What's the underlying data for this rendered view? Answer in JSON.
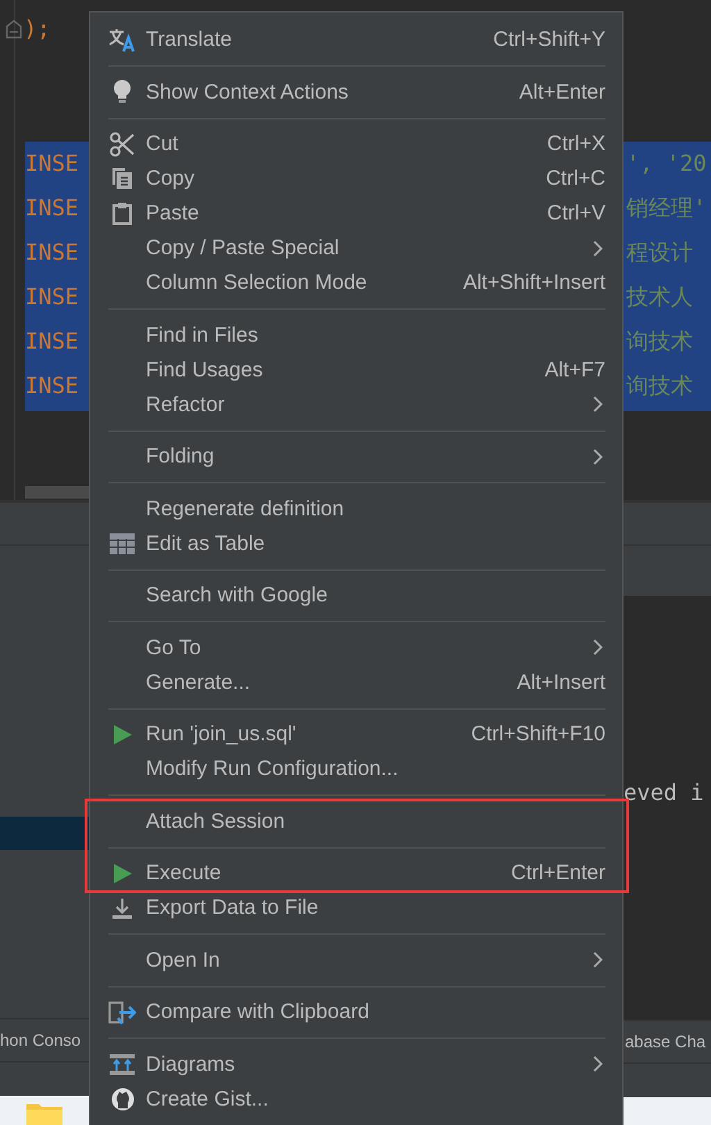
{
  "editor": {
    "top_line": ");",
    "selected_lines": [
      "INSE",
      "INSE",
      "INSE",
      "INSE",
      "INSE",
      "INSE"
    ],
    "right_fragments": [
      "', '20",
      "销经理'",
      "程设计",
      "技术人",
      "询技术",
      "询技术"
    ]
  },
  "console": {
    "output_fragment": "eved i"
  },
  "tool_tabs": [
    "hon Conso",
    "abase Cha"
  ],
  "context_menu": {
    "groups": [
      [
        {
          "label": "Translate",
          "shortcut": "Ctrl+Shift+Y",
          "submenu": false
        }
      ],
      [
        {
          "label": "Show Context Actions",
          "shortcut": "Alt+Enter",
          "submenu": false
        }
      ],
      [
        {
          "label": "Cut",
          "shortcut": "Ctrl+X",
          "submenu": false
        },
        {
          "label": "Copy",
          "shortcut": "Ctrl+C",
          "submenu": false
        },
        {
          "label": "Paste",
          "shortcut": "Ctrl+V",
          "submenu": false
        },
        {
          "label": "Copy / Paste Special",
          "submenu": true
        },
        {
          "label": "Column Selection Mode",
          "shortcut": "Alt+Shift+Insert",
          "submenu": false
        }
      ],
      [
        {
          "label": "Find in Files",
          "submenu": false
        },
        {
          "label": "Find Usages",
          "shortcut": "Alt+F7",
          "submenu": false
        },
        {
          "label": "Refactor",
          "submenu": true
        }
      ],
      [
        {
          "label": "Folding",
          "submenu": true
        }
      ],
      [
        {
          "label": "Regenerate definition",
          "submenu": false
        },
        {
          "label": "Edit as Table",
          "submenu": false
        }
      ],
      [
        {
          "label": "Search with Google",
          "submenu": false
        }
      ],
      [
        {
          "label": "Go To",
          "submenu": true
        },
        {
          "label": "Generate...",
          "shortcut": "Alt+Insert",
          "submenu": false
        }
      ],
      [
        {
          "label": "Run 'join_us.sql'",
          "shortcut": "Ctrl+Shift+F10",
          "submenu": false
        },
        {
          "label": "Modify Run Configuration...",
          "submenu": false
        }
      ],
      [
        {
          "label": "Attach Session",
          "submenu": false
        }
      ],
      [
        {
          "label": "Execute",
          "shortcut": "Ctrl+Enter",
          "submenu": false
        },
        {
          "label": "Export Data to File",
          "submenu": false
        }
      ],
      [
        {
          "label": "Open In",
          "submenu": true
        }
      ],
      [
        {
          "label": "Compare with Clipboard",
          "submenu": false
        }
      ],
      [
        {
          "label": "Diagrams",
          "submenu": true
        },
        {
          "label": "Create Gist...",
          "submenu": false
        }
      ]
    ]
  }
}
